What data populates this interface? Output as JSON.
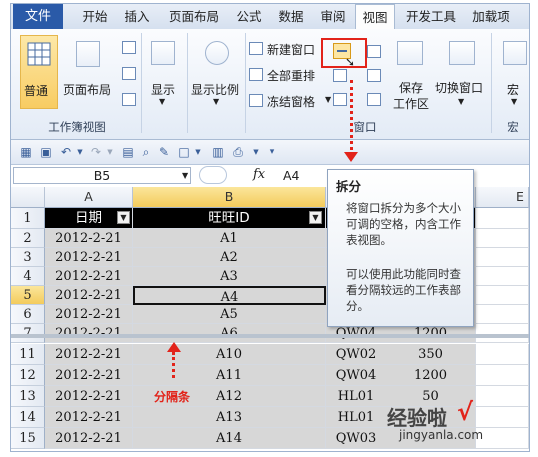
{
  "ribbon": {
    "tabs": [
      "文件",
      "开始",
      "插入",
      "页面布局",
      "公式",
      "数据",
      "审阅",
      "视图",
      "开发工具",
      "加载项"
    ],
    "active_tab": "视图",
    "groups": {
      "workbook_views": {
        "label": "工作簿视图",
        "normal": "普通",
        "page_layout": "页面布局"
      },
      "show": "显示",
      "zoom": "显示比例",
      "window": {
        "label": "窗口",
        "new_window": "新建窗口",
        "arrange_all": "全部重排",
        "freeze_panes": "冻结窗格",
        "save_workspace": [
          "保存",
          "工作区"
        ],
        "switch_windows": "切换窗口"
      },
      "macros": {
        "label": "宏",
        "button": "宏"
      }
    }
  },
  "formula_bar": {
    "name_box": "B5",
    "fx": "fx",
    "value": "A4"
  },
  "grid": {
    "columns": [
      "A",
      "B"
    ],
    "partial_column": "E",
    "header_row": {
      "num": "1",
      "a": "日期",
      "b": "旺旺ID",
      "c": "额"
    },
    "rows_top": [
      {
        "num": "2",
        "a": "2012-2-21",
        "b": "A1",
        "c": "",
        "d": ""
      },
      {
        "num": "3",
        "a": "2012-2-21",
        "b": "A2",
        "c": "",
        "d": ""
      },
      {
        "num": "4",
        "a": "2012-2-21",
        "b": "A3",
        "c": "",
        "d": ""
      },
      {
        "num": "5",
        "a": "2012-2-21",
        "b": "A4",
        "c": "",
        "d": ""
      },
      {
        "num": "6",
        "a": "2012-2-21",
        "b": "A5",
        "c": "",
        "d": ""
      },
      {
        "num": "7",
        "a": "2012-2-21",
        "b": "A6",
        "c": "QW04",
        "d": "1200"
      }
    ],
    "rows_bottom": [
      {
        "num": "11",
        "a": "2012-2-21",
        "b": "A10",
        "c": "QW02",
        "d": "350"
      },
      {
        "num": "12",
        "a": "2012-2-21",
        "b": "A11",
        "c": "QW04",
        "d": "1200"
      },
      {
        "num": "13",
        "a": "2012-2-21",
        "b": "A12",
        "c": "HL01",
        "d": "50"
      },
      {
        "num": "14",
        "a": "2012-2-21",
        "b": "A13",
        "c": "HL01",
        "d": ""
      },
      {
        "num": "15",
        "a": "2012-2-21",
        "b": "A14",
        "c": "QW03",
        "d": ""
      }
    ]
  },
  "tooltip": {
    "title": "拆分",
    "p1": "将窗口拆分为多个大小可调的空格，内含工作表视图。",
    "p2": "可以使用此功能同时查看分隔较远的工作表部分。"
  },
  "annotation": "分隔条",
  "watermark": {
    "line1": "经验啦",
    "line2": "jingyanla.com",
    "check": "√"
  },
  "colors": {
    "accent": "#2a5aa8",
    "highlight": "#e2231a",
    "selected": "#f8cc62"
  }
}
